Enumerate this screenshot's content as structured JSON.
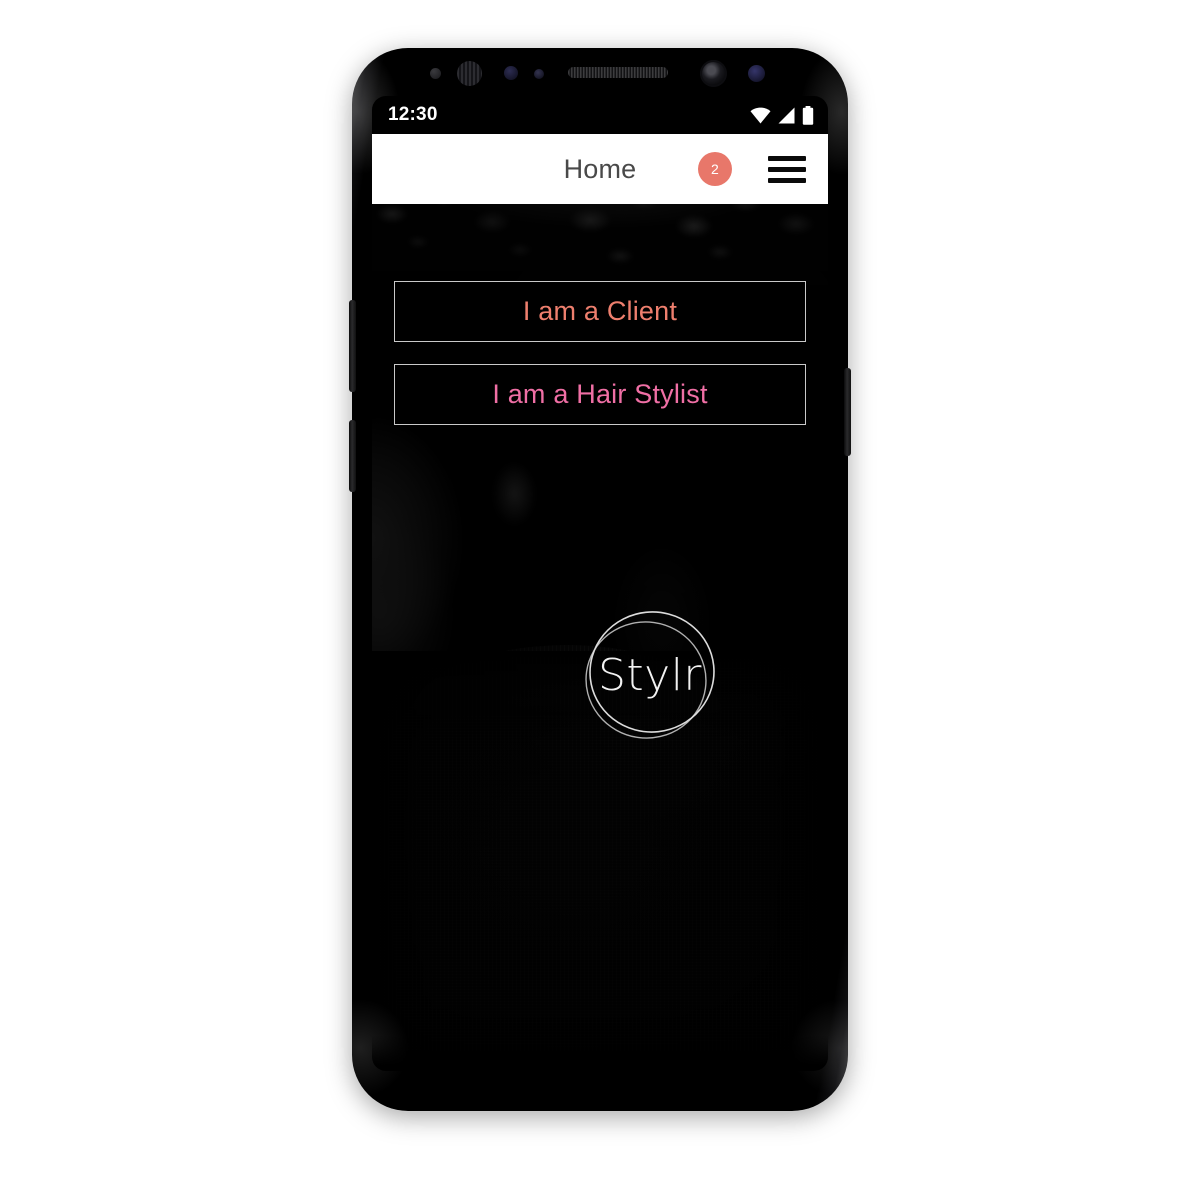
{
  "device": {
    "name": "android-smartphone-mockup",
    "bezel_icons": [
      "proximity-sensor-dot",
      "iris-scanner",
      "front-sensor-dot",
      "light-sensor-dot",
      "earpiece-speaker",
      "front-camera",
      "infrared-sensor"
    ],
    "hardware_buttons": [
      "volume-button",
      "bixby-button",
      "power-button"
    ]
  },
  "status_bar": {
    "time": "12:30",
    "icons": [
      "wifi-icon",
      "cellular-signal-icon",
      "battery-icon"
    ]
  },
  "app_bar": {
    "title": "Home",
    "badge_count": "2",
    "badge_color": "#e8776a",
    "menu_icon": "hamburger-menu-icon",
    "background": "#ffffff",
    "title_color": "#494949"
  },
  "hero": {
    "description": "black-and-white portrait photograph background",
    "background_color": "#000000"
  },
  "choices": [
    {
      "id": "client",
      "label": "I am a Client",
      "text_color": "#ee7f6e",
      "border_color": "#c9c9c9"
    },
    {
      "id": "stylist",
      "label": "I am a Hair Stylist",
      "text_color": "#f06fa5",
      "border_color": "#c9c9c9"
    }
  ],
  "logo": {
    "text": "Stylr",
    "color": "#f2f2f2",
    "shape": "double-hand-drawn-circle"
  },
  "page_background": "#ffffff"
}
